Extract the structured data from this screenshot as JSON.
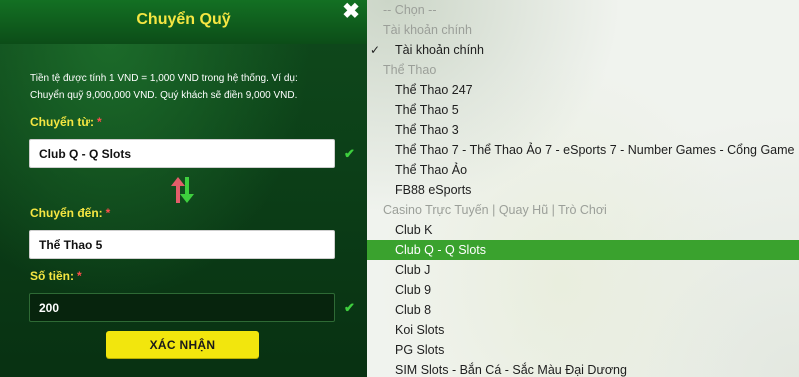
{
  "modal": {
    "title": "Chuyển Quỹ",
    "info_line1": "Tiền tệ được tính 1 VND = 1,000 VND trong hệ thống. Ví dụ:",
    "info_line2": "Chuyển quỹ 9,000,000 VND. Quý khách sẽ điền 9,000 VND.",
    "from_label": "Chuyển từ:",
    "from_value": "Club Q - Q Slots",
    "to_label": "Chuyển đến:",
    "to_value": "Thể Thao 5",
    "amount_label": "Số tiền:",
    "amount_value": "200",
    "required_mark": "*",
    "confirm_label": "XÁC NHẬN",
    "close_glyph": "✖",
    "check_glyph": "✔",
    "icons": {
      "close": "close-icon",
      "swap": "swap-arrows-icon",
      "check": "checkmark-icon"
    },
    "colors": {
      "title": "#f5e642",
      "confirm_bg": "#f2e60d",
      "valid": "#3ecf3e",
      "swap_up": "#e35d6a",
      "swap_down": "#3ecf3e"
    }
  },
  "dropdown": {
    "placeholder": "-- Chọn --",
    "tick_glyph": "✓",
    "items": [
      {
        "kind": "group",
        "label": "Tài khoản chính"
      },
      {
        "kind": "option",
        "label": "Tài khoản chính",
        "checked": true
      },
      {
        "kind": "group",
        "label": "Thể Thao"
      },
      {
        "kind": "option",
        "label": "Thể Thao 247"
      },
      {
        "kind": "option",
        "label": "Thể Thao 5"
      },
      {
        "kind": "option",
        "label": "Thể Thao 3"
      },
      {
        "kind": "option",
        "label": "Thể Thao 7 - Thể Thao Ảo 7 - eSports 7 - Number Games - Cổng Game"
      },
      {
        "kind": "option",
        "label": "Thể Thao Ảo"
      },
      {
        "kind": "option",
        "label": "FB88 eSports"
      },
      {
        "kind": "group",
        "label": "Casino Trực Tuyến | Quay Hũ | Trò Chơi"
      },
      {
        "kind": "option",
        "label": "Club K"
      },
      {
        "kind": "option",
        "label": "Club Q - Q Slots",
        "highlighted": true
      },
      {
        "kind": "option",
        "label": "Club J"
      },
      {
        "kind": "option",
        "label": "Club 9"
      },
      {
        "kind": "option",
        "label": "Club 8"
      },
      {
        "kind": "option",
        "label": "Koi Slots"
      },
      {
        "kind": "option",
        "label": "PG Slots"
      },
      {
        "kind": "option",
        "label": "SIM Slots - Bắn Cá - Sắc Màu Đại Dương"
      }
    ],
    "colors": {
      "highlight": "#3aa22e",
      "group_text": "#9b9f99"
    }
  }
}
